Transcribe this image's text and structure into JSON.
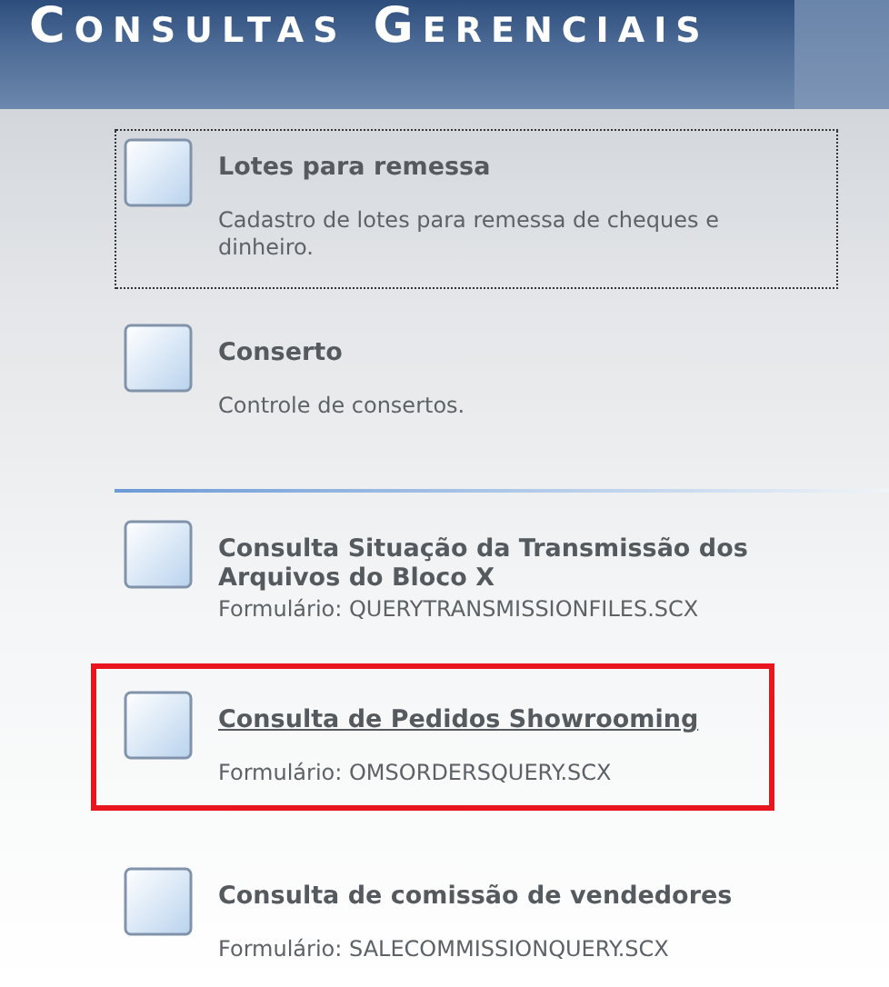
{
  "header": {
    "title": "Consultas Gerenciais"
  },
  "items": [
    {
      "kind": "entry",
      "title": "Lotes para remessa",
      "subtitle": "Cadastro de lotes para remessa de cheques e dinheiro.",
      "focused": true,
      "hovered": false,
      "highlighted": false
    },
    {
      "kind": "entry",
      "title": "Conserto",
      "subtitle": "Controle de consertos.",
      "focused": false,
      "hovered": false,
      "highlighted": false
    },
    {
      "kind": "separator"
    },
    {
      "kind": "entry",
      "title": "Consulta Situação da Transmissão dos Arquivos do Bloco X",
      "subtitle": "Formulário: QUERYTRANSMISSIONFILES.SCX",
      "focused": false,
      "hovered": false,
      "highlighted": false
    },
    {
      "kind": "entry",
      "title": "Consulta de Pedidos Showrooming",
      "subtitle": "Formulário: OMSORDERSQUERY.SCX",
      "focused": false,
      "hovered": true,
      "highlighted": true
    },
    {
      "kind": "entry",
      "title": "Consulta de comissão de vendedores",
      "subtitle": "Formulário: SALECOMMISSIONQUERY.SCX",
      "focused": false,
      "hovered": false,
      "highlighted": false
    }
  ]
}
